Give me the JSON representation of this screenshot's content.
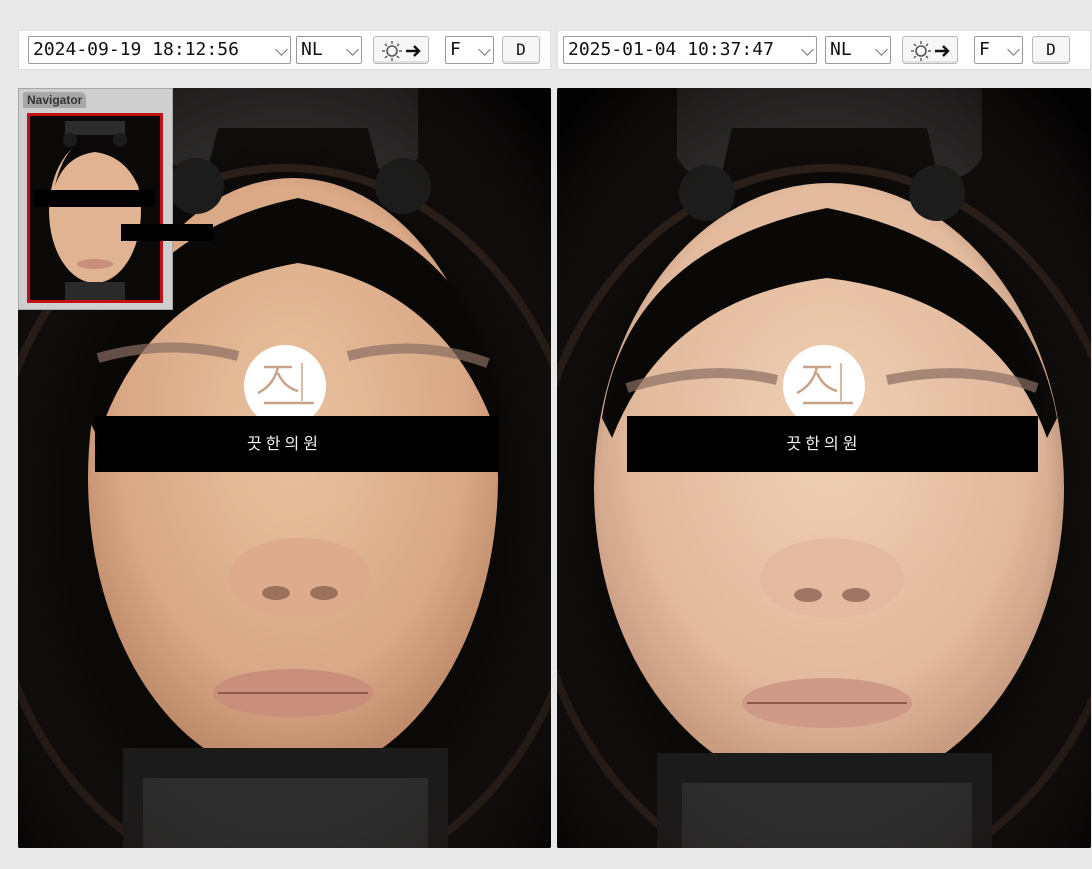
{
  "left": {
    "datetime": "2024-09-19 18:12:56",
    "light_mode": "NL",
    "view": "F",
    "d_button": "D",
    "watermark": "끗한의원"
  },
  "right": {
    "datetime": "2025-01-04 10:37:47",
    "light_mode": "NL",
    "view": "F",
    "d_button": "D",
    "watermark": "끗한의원"
  },
  "navigator": {
    "title": "Navigator"
  },
  "icons": {
    "light_toggle": "lightbulb-arrow-icon",
    "dropdown": "chevron-down-icon",
    "logo": "clinic-logo"
  },
  "colors": {
    "nav_frame": "#c41212",
    "logo_accent": "#c9a28a",
    "skin": "#e2b896"
  }
}
